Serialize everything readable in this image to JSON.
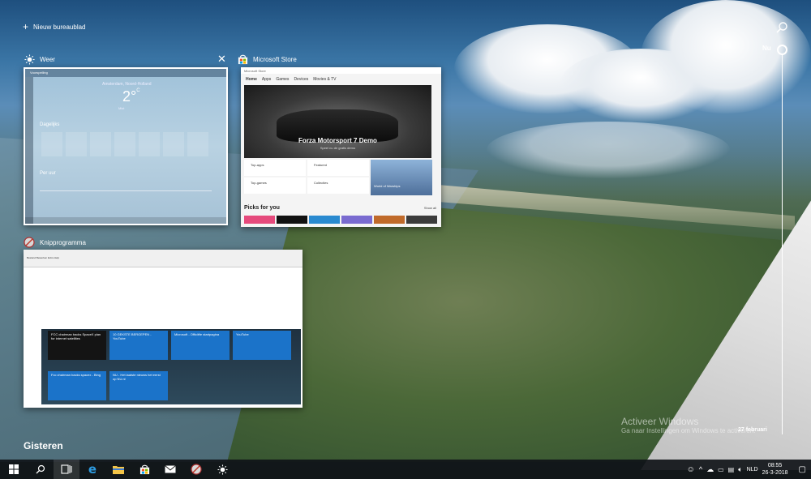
{
  "desktop": {
    "new_desktop_label": "Nieuw bureaublad"
  },
  "windows": {
    "weer": {
      "title": "Weer",
      "app_bar": "Voorspelling",
      "city": "Amsterdam, Noord-Holland",
      "temperature": "2°",
      "unit": "C",
      "condition": "Mist",
      "day_heading": "Dagelijks",
      "per_hour": "Per uur"
    },
    "store": {
      "title": "Microsoft Store",
      "window_label": "Microsoft Store",
      "nav": [
        "Home",
        "Apps",
        "Games",
        "Devices",
        "Movies & TV"
      ],
      "hero_title": "Forza Motorsport 7 Demo",
      "hero_sub": "Speel nu de gratis demo",
      "tiles": [
        "Top-apps",
        "Featured",
        "Top-games",
        "Collecties"
      ],
      "promo": "World of Warships",
      "picks_title": "Picks for you",
      "show_all": "Show all"
    },
    "knip": {
      "title": "Knipprogramma",
      "menu": "Bestand  Bewerken  Extra  Help",
      "tiles": [
        {
          "title": "FCC chairman backs SpaceX plan for internet satellites",
          "dark": true
        },
        {
          "title": "10 GEKSTE BEROEPEN - YouTube",
          "dark": false
        },
        {
          "title": "Microsoft - Officiële startpagina",
          "dark": false
        },
        {
          "title": "YouTube",
          "dark": false
        },
        {
          "title": "Fcc chairman backs spacex - Bing",
          "dark": false
        },
        {
          "title": "NU - Het laatste nieuws het eerst op NU.nl",
          "dark": false
        }
      ]
    }
  },
  "timeline": {
    "now_label": "Nu",
    "date_label": "27 februari",
    "section_label": "Gisteren"
  },
  "watermark": {
    "line1": "Activeer Windows",
    "line2": "Ga naar Instellingen om Windows te activeren."
  },
  "taskbar": {
    "language": "NLD",
    "time": "08:55",
    "date": "26-3-2018"
  },
  "colors": {
    "accent": "#1b73c9",
    "taskbar": "#10141a"
  }
}
